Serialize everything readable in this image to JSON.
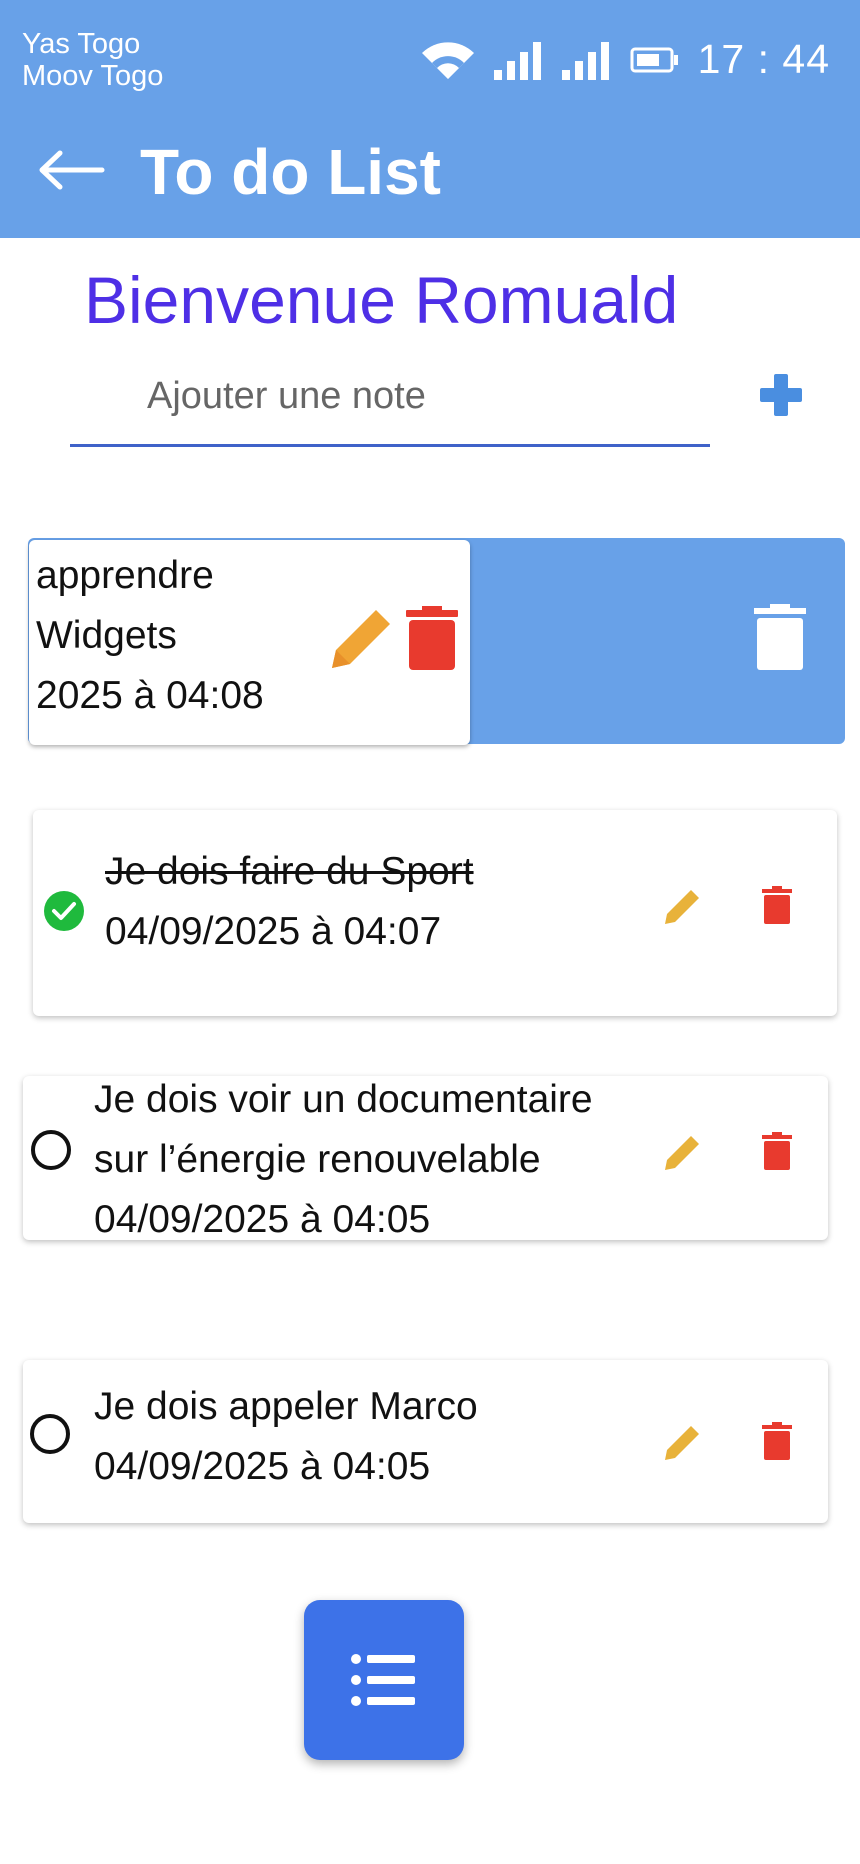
{
  "status_bar": {
    "carrier1": "Yas Togo",
    "carrier2": "Moov Togo",
    "time": "17 : 44"
  },
  "app_bar": {
    "title": "To do List"
  },
  "welcome": "Bienvenue Romuald",
  "note_input": {
    "placeholder": "Ajouter une note"
  },
  "todos": [
    {
      "line1": " apprendre",
      "line2": "Widgets",
      "line3": "2025 à 04:08",
      "done": false,
      "swiped": true
    },
    {
      "text": "Je dois faire du Sport ",
      "date": " 04/09/2025 à 04:07",
      "done": true
    },
    {
      "text1": "Je dois voir un documentaire",
      "text2": "sur l’énergie renouvelable",
      "date": " 04/09/2025 à 04:05",
      "done": false
    },
    {
      "text": "Je dois appeler Marco",
      "date": "04/09/2025 à 04:05",
      "done": false
    }
  ],
  "colors": {
    "app_bar": "#68a1e8",
    "welcome": "#4e2fe6",
    "edit": "#f0a535",
    "delete": "#e83a2e",
    "check": "#1fba3d",
    "fab": "#3d72e8"
  }
}
